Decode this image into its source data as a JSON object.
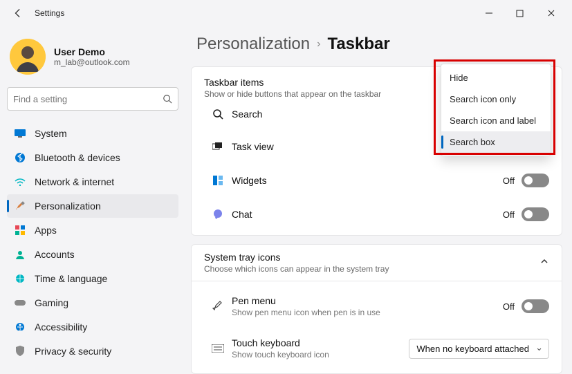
{
  "window": {
    "title": "Settings"
  },
  "user": {
    "name": "User Demo",
    "email": "m_lab@outlook.com"
  },
  "search": {
    "placeholder": "Find a setting"
  },
  "sidebar": {
    "items": [
      {
        "label": "System"
      },
      {
        "label": "Bluetooth & devices"
      },
      {
        "label": "Network & internet"
      },
      {
        "label": "Personalization"
      },
      {
        "label": "Apps"
      },
      {
        "label": "Accounts"
      },
      {
        "label": "Time & language"
      },
      {
        "label": "Gaming"
      },
      {
        "label": "Accessibility"
      },
      {
        "label": "Privacy & security"
      }
    ]
  },
  "breadcrumb": {
    "parent": "Personalization",
    "current": "Taskbar"
  },
  "taskbar_items": {
    "title": "Taskbar items",
    "subtitle": "Show or hide buttons that appear on the taskbar",
    "rows": [
      {
        "label": "Search"
      },
      {
        "label": "Task view",
        "state": "On"
      },
      {
        "label": "Widgets",
        "state": "Off"
      },
      {
        "label": "Chat",
        "state": "Off"
      }
    ]
  },
  "dropdown": {
    "options": [
      {
        "label": "Hide"
      },
      {
        "label": "Search icon only"
      },
      {
        "label": "Search icon and label"
      },
      {
        "label": "Search box"
      }
    ],
    "selected": "Search box"
  },
  "tray": {
    "title": "System tray icons",
    "subtitle": "Choose which icons can appear in the system tray",
    "rows": [
      {
        "label": "Pen menu",
        "sub": "Show pen menu icon when pen is in use",
        "state": "Off"
      },
      {
        "label": "Touch keyboard",
        "sub": "Show touch keyboard icon",
        "select": "When no keyboard attached"
      }
    ]
  }
}
